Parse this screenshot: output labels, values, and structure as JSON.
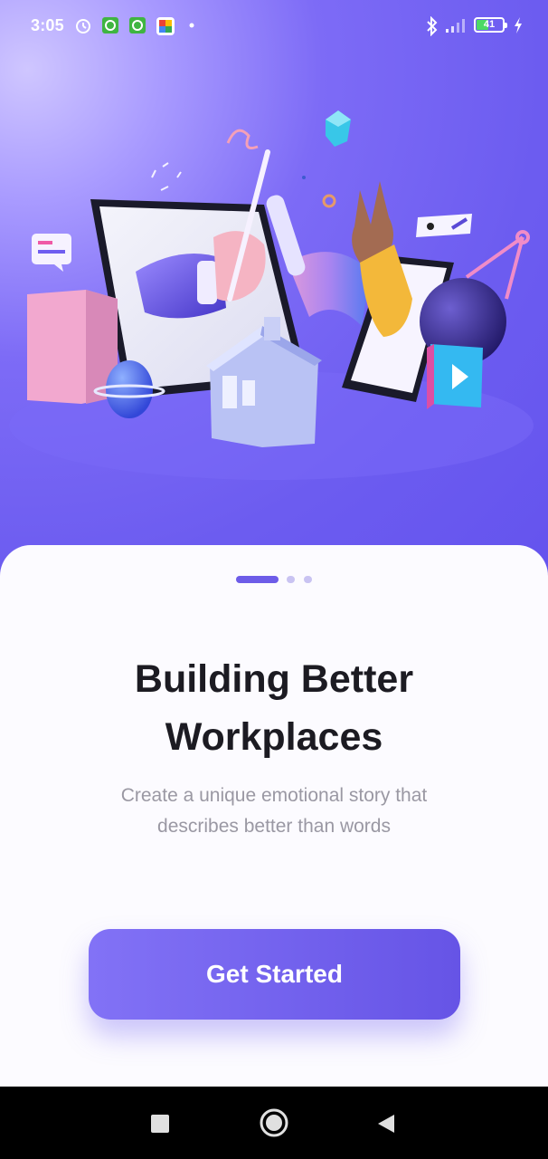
{
  "status_bar": {
    "time": "3:05",
    "battery": "41",
    "icons": [
      "alarm-icon",
      "app-notification-icon",
      "app-notification-icon",
      "photo-app-icon",
      "dot-icon",
      "bluetooth-icon",
      "signal-icon",
      "battery-icon",
      "charging-icon"
    ]
  },
  "onboarding": {
    "page_indicator": {
      "current": 1,
      "total": 3
    },
    "title_line1": "Building Better",
    "title_line2": "Workplaces",
    "subtitle_line1": "Create a unique emotional story that",
    "subtitle_line2": "describes better than words",
    "cta_label": "Get Started",
    "accent_color": "#6D5CE8"
  },
  "navigation_bar": {
    "buttons": [
      "recents-button",
      "home-button",
      "back-button"
    ]
  }
}
